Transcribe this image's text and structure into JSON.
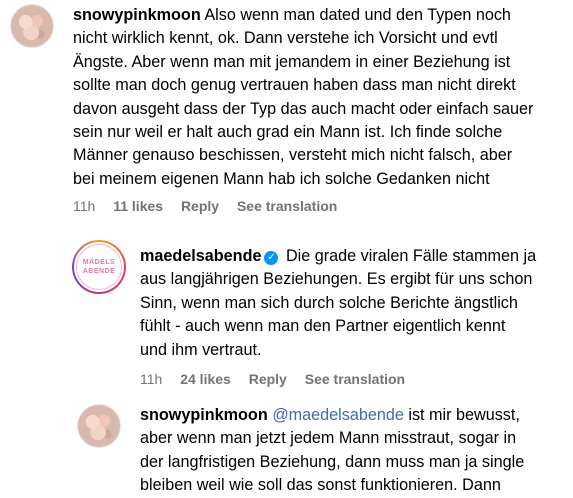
{
  "comments": [
    {
      "username": "snowypinkmoon",
      "lines": [
        "Also wenn man dated und den Typen noch",
        "nicht wirklich kennt, ok. Dann verstehe ich Vorsicht und evtl",
        "Ängste. Aber wenn man mit jemandem in einer Beziehung ist",
        "sollte man doch genug vertrauen haben dass man nicht direkt",
        "davon ausgeht dass der Typ das auch macht oder einfach sauer",
        "sein nur weil er halt auch grad ein Mann ist. Ich finde solche",
        "Männer genauso beschissen, versteht mich nicht falsch, aber",
        "bei meinem eigenen Mann hab ich solche Gedanken nicht"
      ],
      "time": "11h",
      "likes": "11 likes",
      "reply": "Reply",
      "translate": "See translation",
      "avatar_icon": "profile-photo"
    },
    {
      "username": "maedelsabende",
      "verified_icon": "verified-badge-icon",
      "avatar_text_1": "MÄDELS",
      "avatar_text_2": "ABENDE",
      "lines": [
        "Die grade viralen Fälle stammen ja",
        "aus langjährigen Beziehungen. Es ergibt für uns schon",
        "Sinn, wenn man sich durch solche Berichte ängstlich",
        "fühlt - auch wenn man den Partner eigentlich kennt",
        "und ihm vertraut."
      ],
      "time": "11h",
      "likes": "24 likes",
      "reply": "Reply",
      "translate": "See translation"
    },
    {
      "username": "snowypinkmoon",
      "mention": "@maedelsabende",
      "lines": [
        "ist mir bewusst,",
        "aber wenn man jetzt jedem Mann misstraut, sogar in",
        "der langfristigen Beziehung, dann muss man ja single",
        "bleiben weil wie soll das sonst funktionieren. Dann"
      ]
    }
  ],
  "colors": {
    "mention": "#4169b7",
    "meta": "#737373",
    "verified": "#0095f6"
  }
}
